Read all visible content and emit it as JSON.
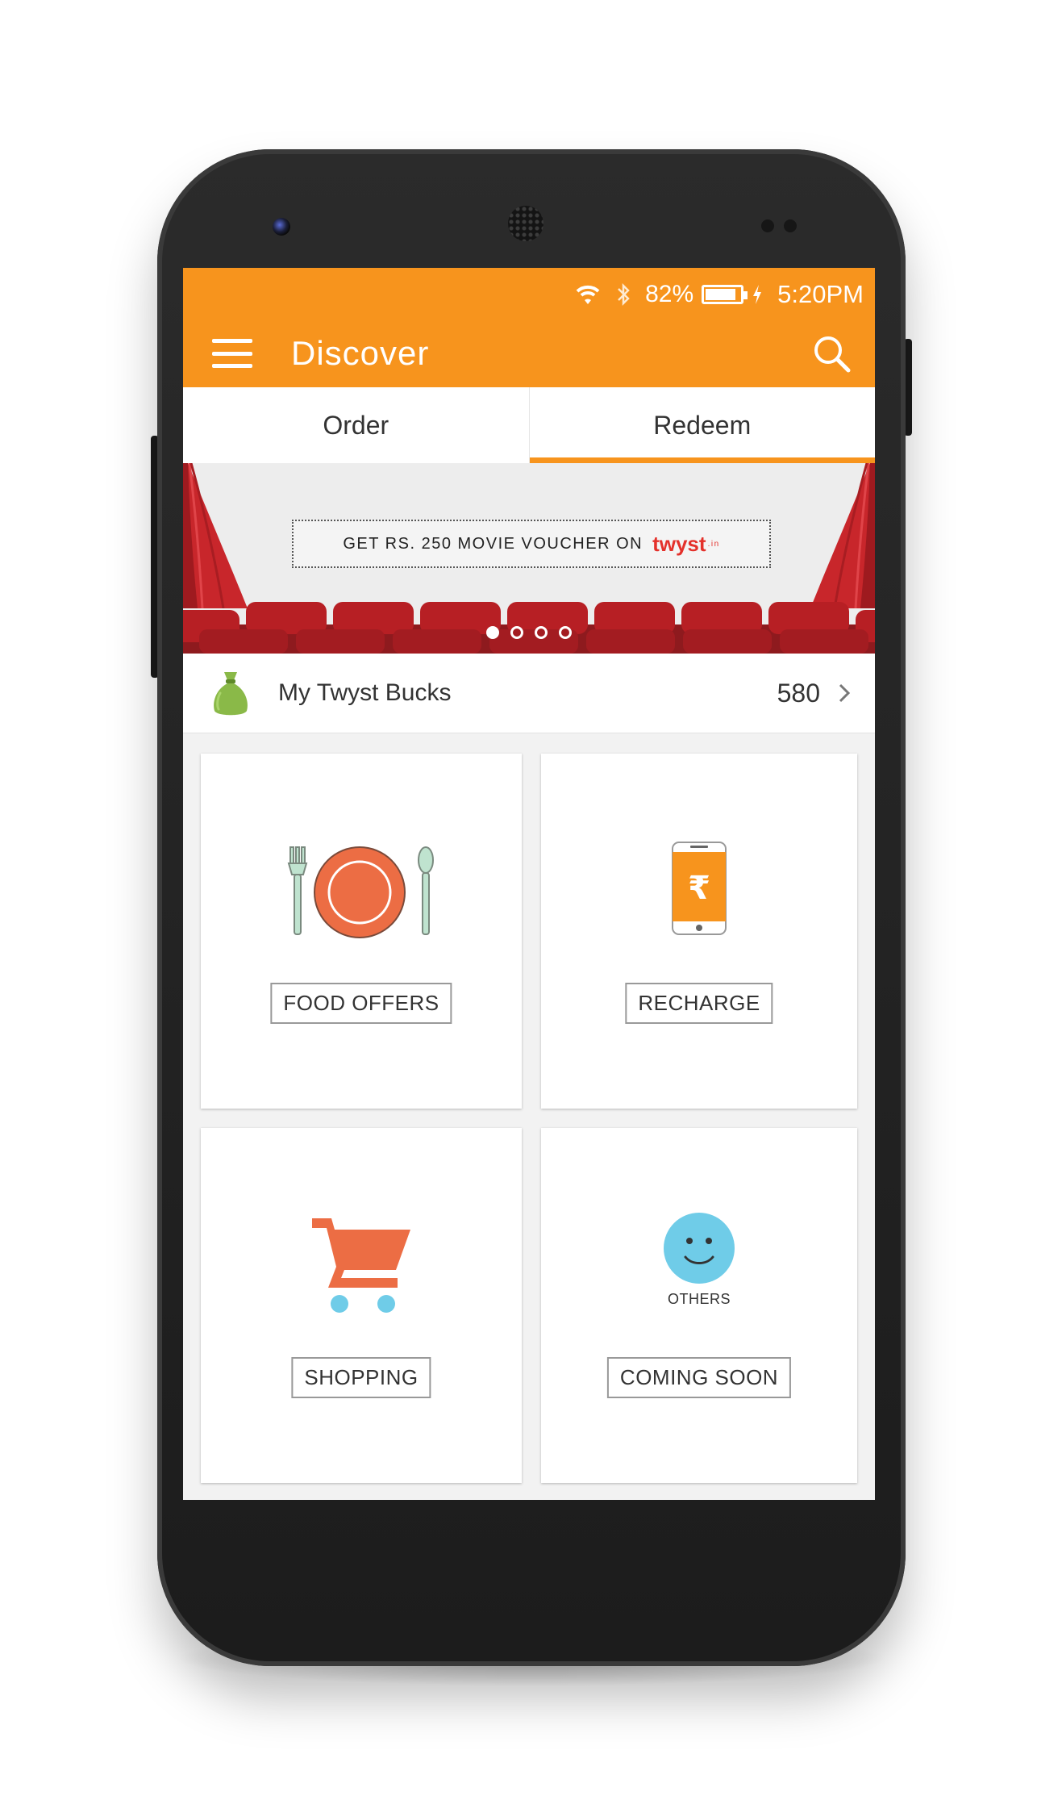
{
  "status_bar": {
    "battery_percent": "82%",
    "time": "5:20PM",
    "battery_level": 0.82
  },
  "toolbar": {
    "title": "Discover",
    "menu_icon": "hamburger-menu-icon",
    "search_icon": "search-icon"
  },
  "tabs": [
    {
      "label": "Order",
      "active": false
    },
    {
      "label": "Redeem",
      "active": true
    }
  ],
  "banner": {
    "voucher_text": "GET RS. 250 MOVIE VOUCHER ON",
    "brand": "twyst",
    "brand_tld": ".in",
    "slides": 4,
    "active_slide": 1
  },
  "bucks": {
    "label": "My Twyst Bucks",
    "value": "580",
    "icon": "money-bag-icon"
  },
  "categories": [
    {
      "label": "FOOD OFFERS",
      "icon": "plate-cutlery-icon"
    },
    {
      "label": "RECHARGE",
      "icon": "phone-rupee-icon"
    },
    {
      "label": "SHOPPING",
      "icon": "shopping-cart-icon"
    },
    {
      "label": "COMING SOON",
      "icon": "smiley-icon",
      "icon_caption": "OTHERS"
    }
  ],
  "colors": {
    "accent": "#f7941d",
    "icon_orange": "#ec6d44",
    "icon_blue": "#6fcce8",
    "curtain_red": "#c8262b"
  }
}
